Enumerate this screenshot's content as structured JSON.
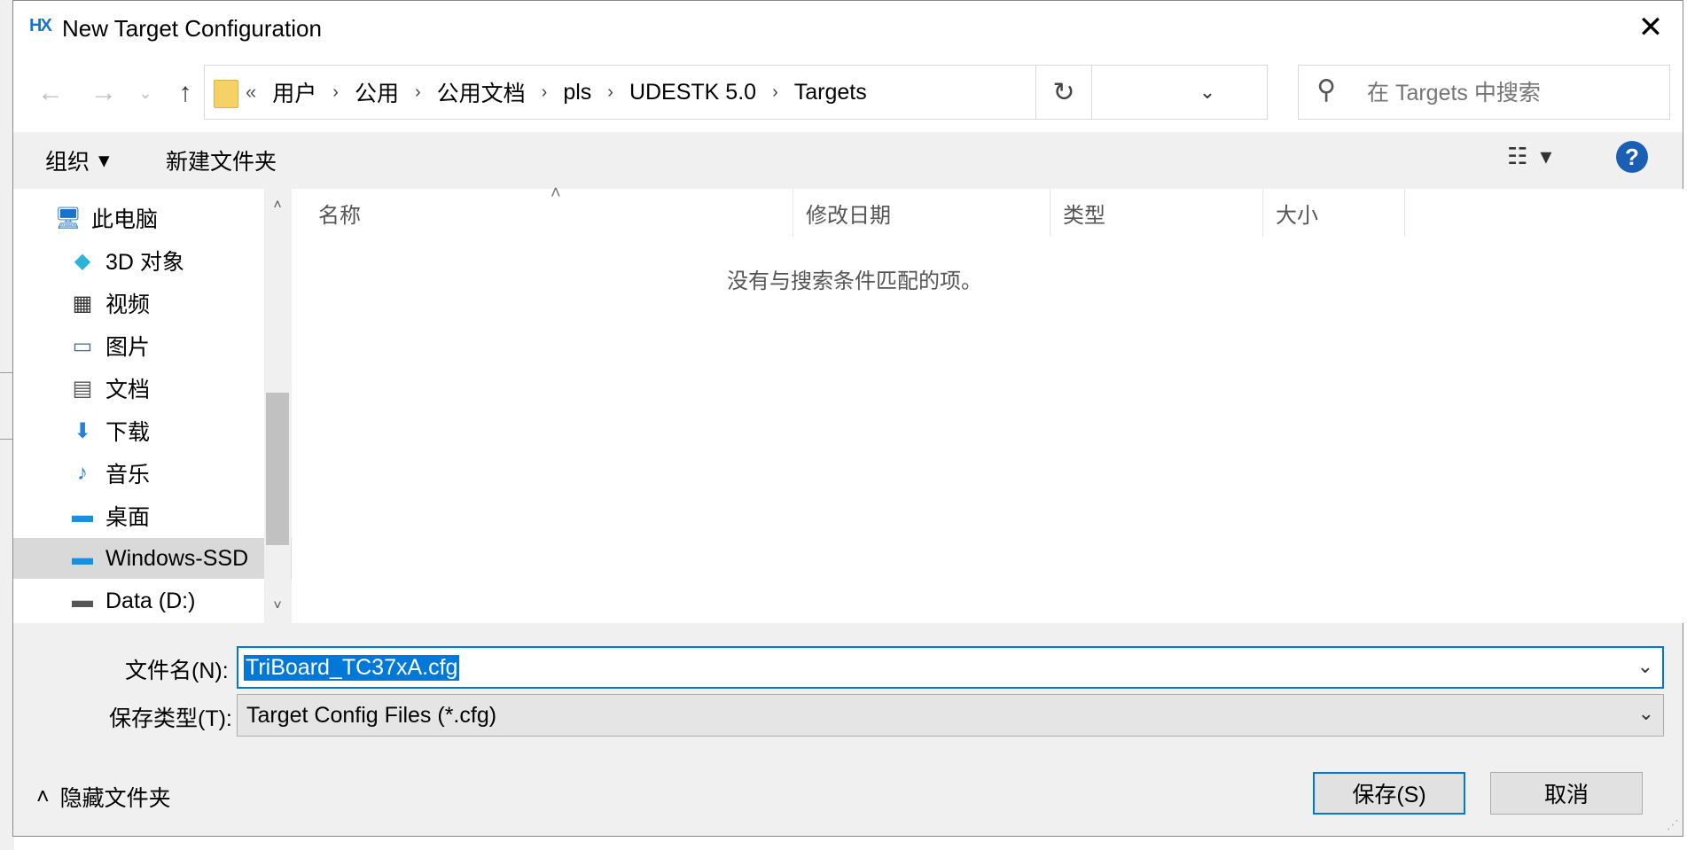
{
  "window": {
    "app_icon": "HX",
    "title": "New Target Configuration",
    "close_glyph": "✕"
  },
  "nav": {
    "back_glyph": "←",
    "forward_glyph": "→",
    "recent_glyph": "⌄",
    "up_glyph": "↑"
  },
  "address": {
    "overflow": "«",
    "crumbs": [
      "用户",
      "公用",
      "公用文档",
      "pls",
      "UDESTK 5.0",
      "Targets"
    ],
    "separator": "›",
    "dropdown_glyph": "⌄",
    "refresh_glyph": "↻"
  },
  "search": {
    "placeholder": "在 Targets 中搜索",
    "icon": "search-icon"
  },
  "toolbar": {
    "organize_label": "组织",
    "organize_arrow": "▾",
    "new_folder_label": "新建文件夹",
    "view_glyph": "☷",
    "view_arrow": "▾",
    "help_label": "?"
  },
  "sidebar": {
    "items": [
      {
        "label": "此电脑",
        "icon": "pc-icon",
        "glyph": "🖥"
      },
      {
        "label": "3D 对象",
        "icon": "3d-objects-icon",
        "glyph": "◆"
      },
      {
        "label": "视频",
        "icon": "video-icon",
        "glyph": "▦"
      },
      {
        "label": "图片",
        "icon": "pictures-icon",
        "glyph": "▭"
      },
      {
        "label": "文档",
        "icon": "documents-icon",
        "glyph": "▤"
      },
      {
        "label": "下载",
        "icon": "downloads-icon",
        "glyph": "⬇"
      },
      {
        "label": "音乐",
        "icon": "music-icon",
        "glyph": "♪"
      },
      {
        "label": "桌面",
        "icon": "desktop-icon",
        "glyph": "▬"
      },
      {
        "label": "Windows-SSD",
        "icon": "drive-c-icon",
        "glyph": "▬",
        "selected": true
      },
      {
        "label": "Data (D:)",
        "icon": "drive-d-icon",
        "glyph": "▬"
      }
    ],
    "scroll_up": "˄",
    "scroll_down": "˅"
  },
  "filelist": {
    "columns": [
      "名称",
      "修改日期",
      "类型",
      "大小"
    ],
    "sort_glyph": "˄",
    "empty_message": "没有与搜索条件匹配的项。"
  },
  "form": {
    "filename_label": "文件名(N):",
    "filename_value": "TriBoard_TC37xA.cfg",
    "filetype_label": "保存类型(T):",
    "filetype_value": "Target Config Files (*.cfg)",
    "chevron": "⌄"
  },
  "footer": {
    "hide_folders_glyph": "˄",
    "hide_folders_label": "隐藏文件夹",
    "save_label": "保存(S)",
    "cancel_label": "取消",
    "grip": "⋰"
  },
  "colors": {
    "accent": "#0078d7",
    "help": "#1a5fb4",
    "folder": "#f5d265"
  }
}
